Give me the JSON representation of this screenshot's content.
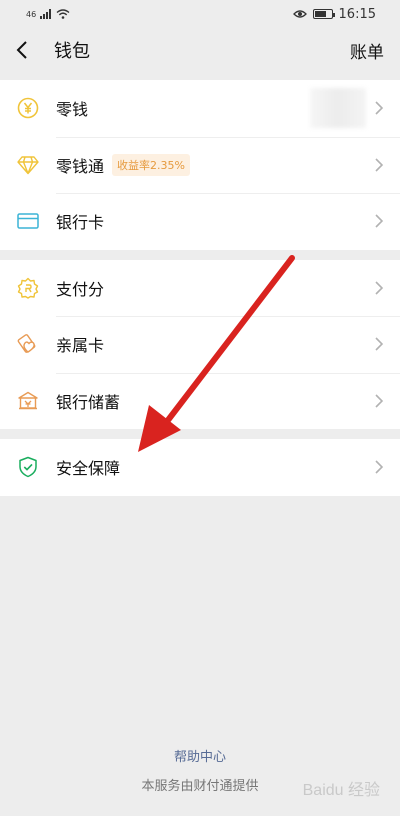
{
  "status": {
    "signal": "46",
    "time": "16:15"
  },
  "nav": {
    "title": "钱包",
    "right": "账单"
  },
  "groups": [
    {
      "items": [
        {
          "label": "零钱",
          "icon": "coin-yuan-icon"
        },
        {
          "label": "零钱通",
          "icon": "diamond-icon",
          "badge": "收益率2.35%"
        },
        {
          "label": "银行卡",
          "icon": "bank-card-icon"
        }
      ]
    },
    {
      "items": [
        {
          "label": "支付分",
          "icon": "score-badge-icon"
        },
        {
          "label": "亲属卡",
          "icon": "family-card-icon"
        },
        {
          "label": "银行储蓄",
          "icon": "bank-building-icon"
        }
      ]
    },
    {
      "items": [
        {
          "label": "安全保障",
          "icon": "shield-check-icon"
        }
      ]
    }
  ],
  "footer": {
    "help": "帮助中心",
    "provider": "本服务由财付通提供"
  },
  "watermark": "Baidu 经验",
  "colors": {
    "yellow": "#f0c43a",
    "blue": "#3bb4d6",
    "orange": "#e89b55",
    "green": "#1aad5e",
    "arrow": "#d9231f",
    "link": "#576b95"
  }
}
